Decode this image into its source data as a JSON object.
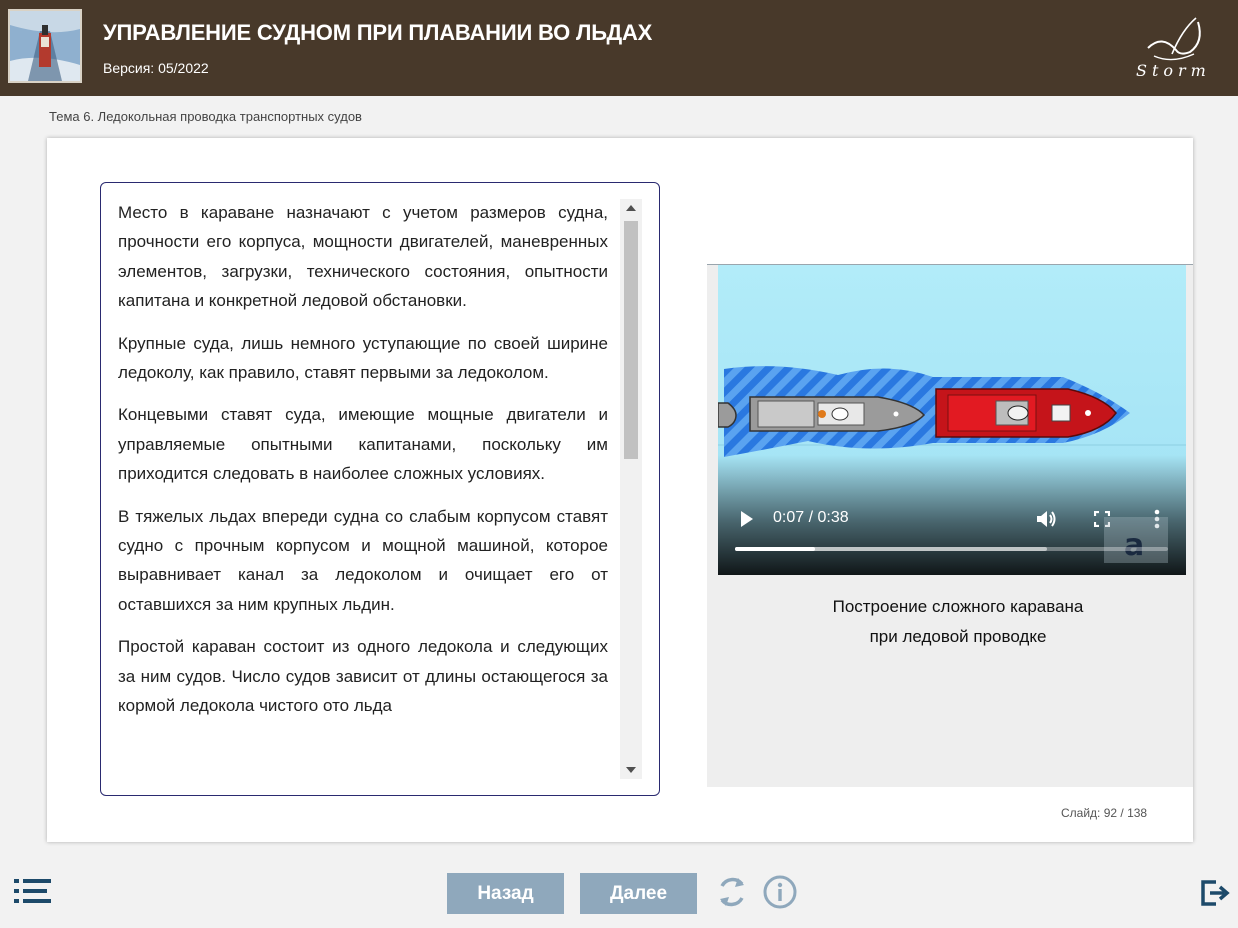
{
  "header": {
    "title": "УПРАВЛЕНИЕ СУДНОМ ПРИ ПЛАВАНИИ ВО ЛЬДАХ",
    "version": "Версия: 05/2022",
    "logo_text": "Storm"
  },
  "breadcrumb": "Тема 6. Ледокольная проводка транспортных судов",
  "content": {
    "paragraphs": [
      "Место в караване назначают с учетом размеров судна, прочности его корпуса, мощности двигателей, маневренных элементов, загрузки, технического состояния, опытности капитана и конкретной ледовой обстановки.",
      "Крупные суда, лишь немного уступающие по своей ширине ледоколу, как правило, ставят первыми за ледоколом.",
      "Концевыми ставят суда, имеющие мощные двигатели и управляемые опытными капитанами, поскольку им приходится следовать в наиболее сложных условиях.",
      "В тяжелых льдах впереди судна со слабым корпусом ставят судно с прочным корпусом и мощной машиной, которое выравнивает канал за ледоколом и очищает его от оставшихся за ним крупных льдин.",
      "Простой караван состоит из одного ледокола и следующих за ним судов. Число судов зависит от длины остающегося за кормой ледокола чистого ото льда"
    ]
  },
  "video": {
    "time": "0:07 / 0:38",
    "current_seconds": 7,
    "duration_seconds": 38,
    "buffered_fraction": 0.72,
    "overlay_letter": "a",
    "caption_line1": "Построение сложного каравана",
    "caption_line2": "при ледовой проводке",
    "icons": {
      "play": "play-icon",
      "volume": "volume-icon",
      "fullscreen": "fullscreen-icon",
      "more": "more-icon"
    }
  },
  "slide_counter": "Слайд:  92 / 138",
  "nav": {
    "back_label": "Назад",
    "next_label": "Далее",
    "icons": {
      "menu": "menu-list-icon",
      "reload": "reload-icon",
      "info": "info-icon",
      "exit": "exit-icon"
    }
  },
  "colors": {
    "header_bg": "#48392a",
    "button_bg": "#8fa8bc",
    "icon_color": "#1d4a6a",
    "textbox_border": "#2a2a70"
  }
}
